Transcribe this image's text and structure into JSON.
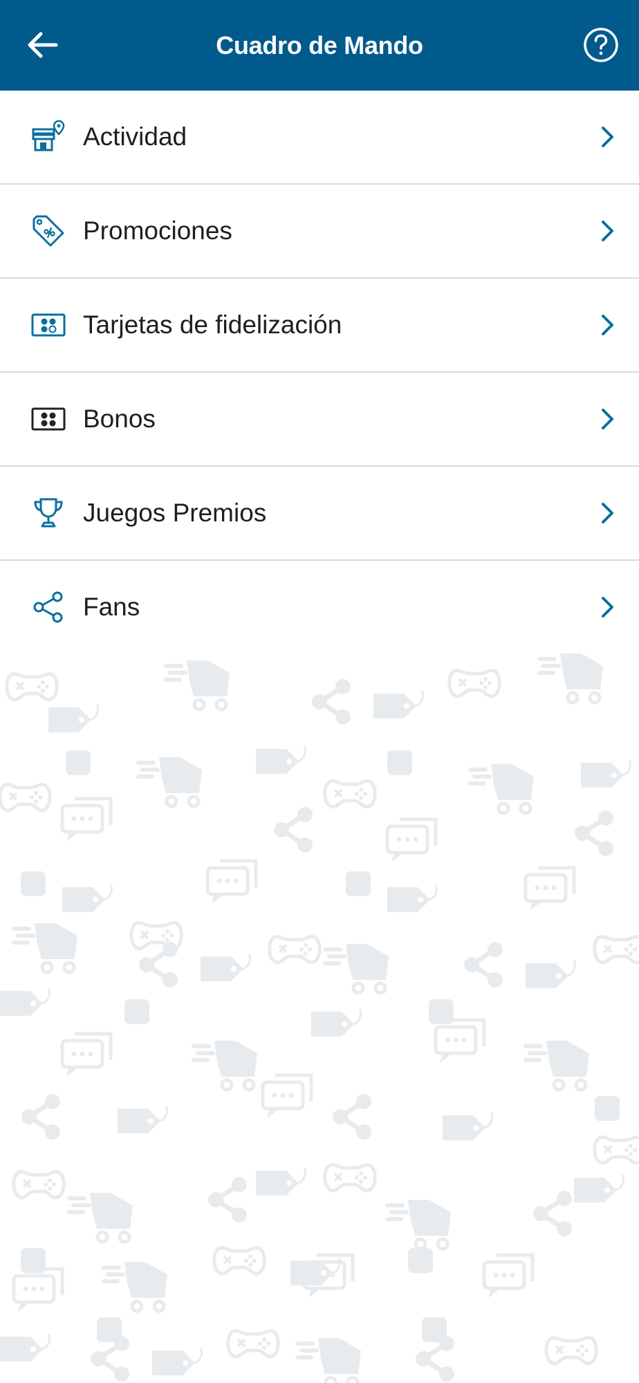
{
  "header": {
    "title": "Cuadro de Mando",
    "back_icon": "arrow-left-icon",
    "help_icon": "help-circle-icon",
    "background_color": "#005a8c"
  },
  "menu": {
    "items": [
      {
        "label": "Actividad",
        "icon": "store-location-icon"
      },
      {
        "label": "Promociones",
        "icon": "discount-tag-icon"
      },
      {
        "label": "Tarjetas de fidelización",
        "icon": "loyalty-card-icon"
      },
      {
        "label": "Bonos",
        "icon": "voucher-card-icon"
      },
      {
        "label": "Juegos Premios",
        "icon": "trophy-icon"
      },
      {
        "label": "Fans",
        "icon": "share-icon"
      }
    ],
    "chevron_icon": "chevron-right-icon",
    "accent_color": "#0a6f9e"
  },
  "background": {
    "pattern": "decorative-icons-pattern",
    "pattern_color": "#e6e9ec"
  }
}
